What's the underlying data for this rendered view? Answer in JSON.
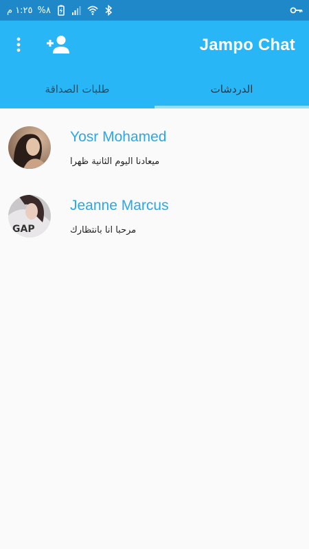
{
  "status_bar": {
    "time": "١:٢٥ م",
    "battery": "%٨",
    "bg_color": "#1e88c8",
    "icons": [
      "battery-icon",
      "signal-icon",
      "wifi-icon",
      "bluetooth-icon",
      "key-icon"
    ]
  },
  "app_bar": {
    "title": "Jampo Chat",
    "bg_color": "#29b6f6",
    "icons": [
      "more-vert-icon",
      "person-add-icon"
    ]
  },
  "tabs": [
    {
      "label": "الدردشات",
      "active": true
    },
    {
      "label": "طلبات الصداقة",
      "active": false
    }
  ],
  "chats": [
    {
      "name": "Yosr Mohamed",
      "message": "ميعادنا اليوم الثانية ظهرا"
    },
    {
      "name": "Jeanne Marcus",
      "message": "مرحبا انا بانتظارك"
    }
  ]
}
